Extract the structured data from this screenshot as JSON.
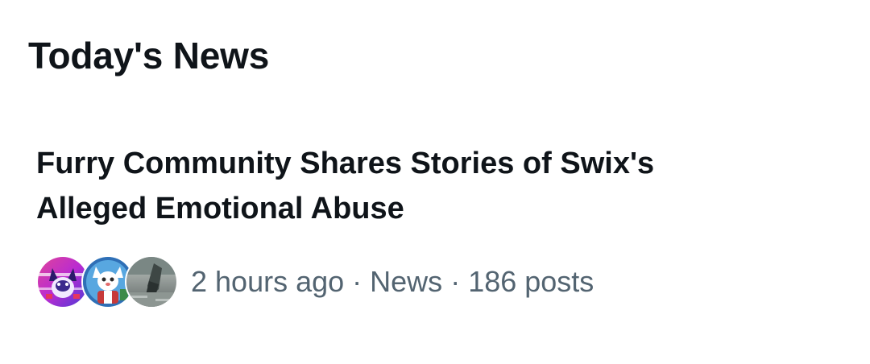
{
  "section": {
    "title": "Today's News"
  },
  "story": {
    "headline": "Furry Community Shares Stories of Swix's Alleged Emotional Abuse",
    "avatars": [
      {
        "icon": "furry-character-avatar-pink"
      },
      {
        "icon": "furry-character-avatar-blue"
      },
      {
        "icon": "photo-avatar-grey"
      }
    ],
    "time": "2 hours ago",
    "separator": "·",
    "category": "News",
    "post_count": "186 posts"
  },
  "colors": {
    "primary_text": "#0f1419",
    "secondary_text": "#536471",
    "background": "#ffffff"
  }
}
